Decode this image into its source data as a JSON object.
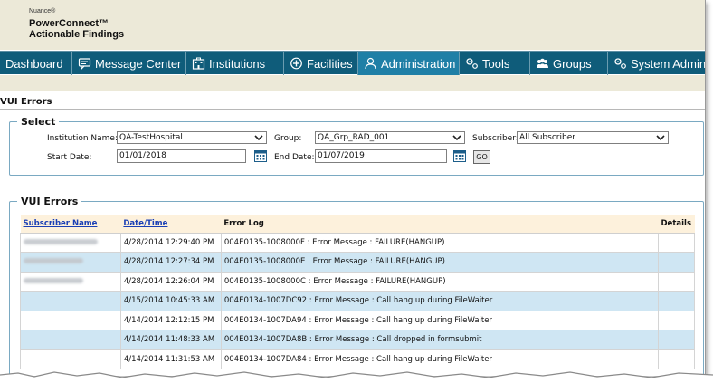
{
  "header": {
    "brand_small": "Nuance®",
    "brand_line1": "PowerConnect™",
    "brand_line2": "Actionable Findings"
  },
  "nav": {
    "items": [
      {
        "label": "Dashboard",
        "icon": "none"
      },
      {
        "label": "Message Center",
        "icon": "message-icon"
      },
      {
        "label": "Institutions",
        "icon": "building-icon"
      },
      {
        "label": "Facilities",
        "icon": "plus-circle-icon"
      },
      {
        "label": "Administration",
        "icon": "user-icon"
      },
      {
        "label": "Tools",
        "icon": "gears-icon"
      },
      {
        "label": "Groups",
        "icon": "group-icon"
      },
      {
        "label": "System Admin",
        "icon": "gears-icon"
      }
    ],
    "active": "Administration"
  },
  "page": {
    "title": "VUI Errors"
  },
  "select": {
    "legend": "Select",
    "institution_label": "Institution Name:",
    "institution_value": "QA-TestHospital",
    "group_label": "Group:",
    "group_value": "QA_Grp_RAD_001",
    "subscriber_label": "Subscriber:",
    "subscriber_value": "All Subscriber",
    "start_label": "Start Date:",
    "start_value": "01/01/2018",
    "end_label": "End Date:",
    "end_value": "01/07/2019",
    "go_label": "GO"
  },
  "errors": {
    "legend": "VUI Errors",
    "columns": [
      "Subscriber Name",
      "Date/Time",
      "Error Log",
      "Details"
    ],
    "rows": [
      {
        "subscriber_redacted": true,
        "datetime": "4/28/2014 12:29:40 PM",
        "log": "004E0135-1008000F : Error Message : FAILURE(HANGUP)"
      },
      {
        "subscriber_redacted": true,
        "datetime": "4/28/2014 12:27:34 PM",
        "log": "004E0135-1008000E : Error Message : FAILURE(HANGUP)"
      },
      {
        "subscriber_redacted": true,
        "datetime": "4/28/2014 12:26:04 PM",
        "log": "004E0135-1008000C : Error Message : FAILURE(HANGUP)"
      },
      {
        "subscriber_redacted": false,
        "datetime": "4/15/2014 10:45:33 AM",
        "log": "004E0134-1007DC92 : Error Message : Call hang up during FileWaiter"
      },
      {
        "subscriber_redacted": false,
        "datetime": "4/14/2014 12:12:15 PM",
        "log": "004E0134-1007DA94 : Error Message : Call hang up during FileWaiter"
      },
      {
        "subscriber_redacted": false,
        "datetime": "4/14/2014 11:48:33 AM",
        "log": "004E0134-1007DA8B : Error Message : Call dropped in formsubmit"
      },
      {
        "subscriber_redacted": false,
        "datetime": "4/14/2014 11:31:53 AM",
        "log": "004E0134-1007DA84 : Error Message : Call hang up during FileWaiter"
      }
    ]
  },
  "colors": {
    "nav_bg": "#0f5c7a",
    "nav_active": "#1f7fa6",
    "header_bg": "#ece9d8",
    "row_alt": "#cfe6f3",
    "table_header": "#fdf1dc",
    "link": "#1a3fb5"
  }
}
